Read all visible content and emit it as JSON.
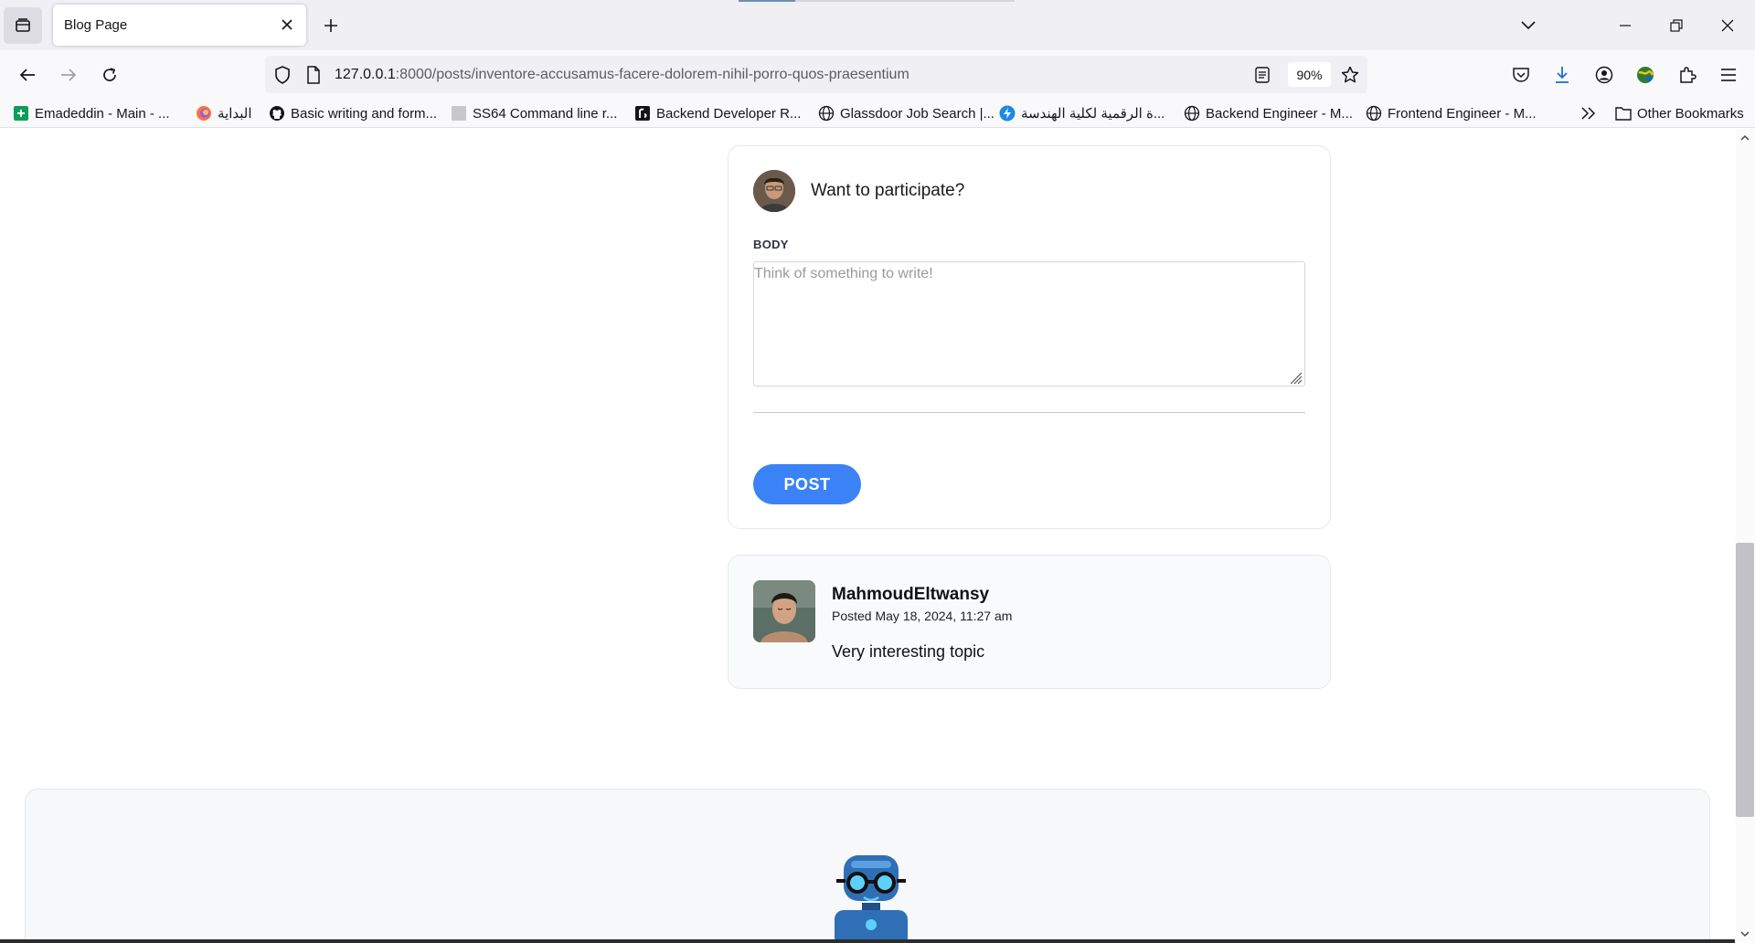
{
  "browser": {
    "tab": {
      "title": "Blog Page"
    },
    "url": {
      "host": "127.0.0.1",
      "rest": ":8000/posts/inventore-accusamus-facere-dolorem-nihil-porro-quos-praesentium"
    },
    "zoom": "90%"
  },
  "bookmarks": [
    {
      "label": "Emadeddin - Main - ...",
      "icon": "sheets-icon"
    },
    {
      "label": "البداية",
      "icon": "firefox-icon"
    },
    {
      "label": "Basic writing and form...",
      "icon": "github-icon"
    },
    {
      "label": "SS64 Command line r...",
      "icon": "page-icon"
    },
    {
      "label": "Backend Developer R...",
      "icon": "roadmap-icon"
    },
    {
      "label": "Glassdoor Job Search |...",
      "icon": "globe-icon"
    },
    {
      "label": "ة الرقمية لكلية الهندسة...",
      "icon": "bolt-icon"
    },
    {
      "label": "Backend Engineer - M...",
      "icon": "globe-icon"
    },
    {
      "label": "Frontend Engineer - M...",
      "icon": "globe-icon"
    },
    {
      "label": "Other Bookmarks",
      "icon": "folder-icon"
    }
  ],
  "comment_form": {
    "prompt": "Want to participate?",
    "body_label": "BODY",
    "placeholder": "Think of something to write!",
    "submit_label": "POST"
  },
  "comments": [
    {
      "author": "MahmoudEltwansy",
      "posted": "Posted May 18, 2024, 11:27 am",
      "body": "Very interesting topic"
    }
  ],
  "colors": {
    "accent": "#3b82f6",
    "card_border": "#e6e7eb",
    "comment_bg": "#f9fafb"
  }
}
